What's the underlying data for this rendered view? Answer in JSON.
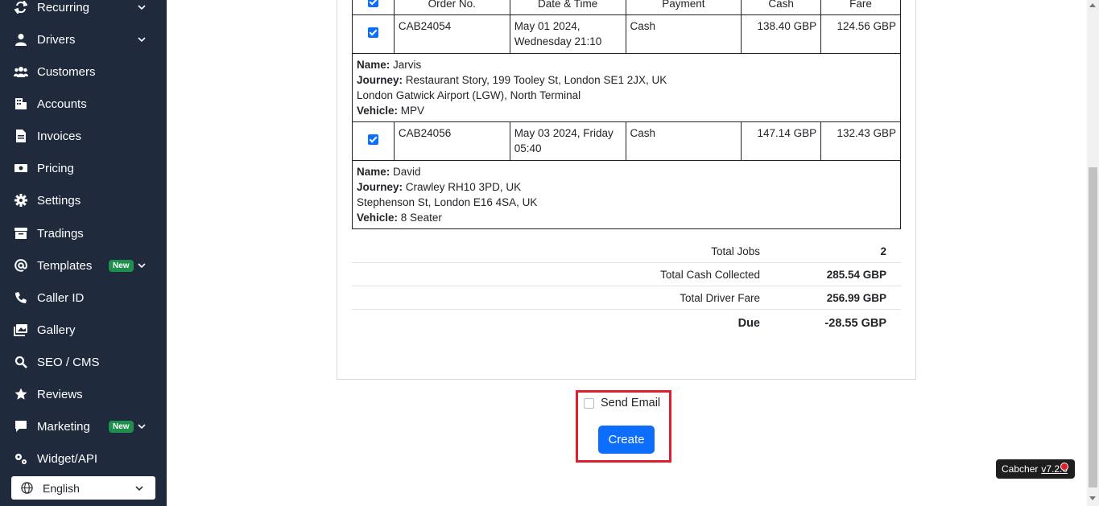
{
  "sidebar": {
    "items": [
      {
        "label": "Recurring",
        "icon": "repeat-icon"
      },
      {
        "label": "Drivers",
        "icon": "user-icon"
      },
      {
        "label": "Customers",
        "icon": "users-icon"
      },
      {
        "label": "Accounts",
        "icon": "building-icon"
      },
      {
        "label": "Invoices",
        "icon": "file-invoice-icon"
      },
      {
        "label": "Pricing",
        "icon": "money-icon"
      },
      {
        "label": "Settings",
        "icon": "gear-icon"
      },
      {
        "label": "Tradings",
        "icon": "archive-icon"
      },
      {
        "label": "Templates",
        "icon": "at-icon",
        "badge": "New"
      },
      {
        "label": "Caller ID",
        "icon": "phone-icon"
      },
      {
        "label": "Gallery",
        "icon": "images-icon"
      },
      {
        "label": "SEO / CMS",
        "icon": "search-icon"
      },
      {
        "label": "Reviews",
        "icon": "star-icon"
      },
      {
        "label": "Marketing",
        "icon": "comment-icon",
        "badge": "New"
      },
      {
        "label": "Widget/API",
        "icon": "gears-icon"
      }
    ],
    "language": "English"
  },
  "table": {
    "header": [
      "Order No.",
      "Date & Time",
      "Payment",
      "Cash",
      "Fare"
    ],
    "jobs": [
      {
        "order": "CAB24054",
        "date_line1": "May 01 2024,",
        "date_line2": "Wednesday 21:10",
        "payment": "Cash",
        "cash": "138.40 GBP",
        "fare": "124.56 GBP",
        "name_label": "Name:",
        "name": "Jarvis",
        "journey_label": "Journey:",
        "journey_from": "Restaurant Story, 199 Tooley St, London SE1 2JX, UK",
        "journey_to": "London Gatwick Airport (LGW), North Terminal",
        "vehicle_label": "Vehicle:",
        "vehicle": "MPV"
      },
      {
        "order": "CAB24056",
        "date_line1": "May 03 2024, Friday",
        "date_line2": "05:40",
        "payment": "Cash",
        "cash": "147.14 GBP",
        "fare": "132.43 GBP",
        "name_label": "Name:",
        "name": "David",
        "journey_label": "Journey:",
        "journey_from": "Crawley RH10 3PD, UK",
        "journey_to": "Stephenson St, London E16 4SA, UK",
        "vehicle_label": "Vehicle:",
        "vehicle": "8 Seater"
      }
    ]
  },
  "totals": {
    "jobs_label": "Total Jobs",
    "jobs_value": "2",
    "cash_label": "Total Cash Collected",
    "cash_value": "285.54 GBP",
    "fare_label": "Total Driver Fare",
    "fare_value": "256.99 GBP",
    "due_label": "Due",
    "due_value": "-28.55 GBP"
  },
  "actions": {
    "send_email_label": "Send Email",
    "create_label": "Create"
  },
  "version": {
    "brand": "Cabcher",
    "number": "v7.2.0"
  },
  "colors": {
    "sidebar_bg": "#1f2a3d",
    "primary": "#0d6efd",
    "badge_green": "#1f8f4e",
    "highlight_red": "#e01f2c"
  }
}
